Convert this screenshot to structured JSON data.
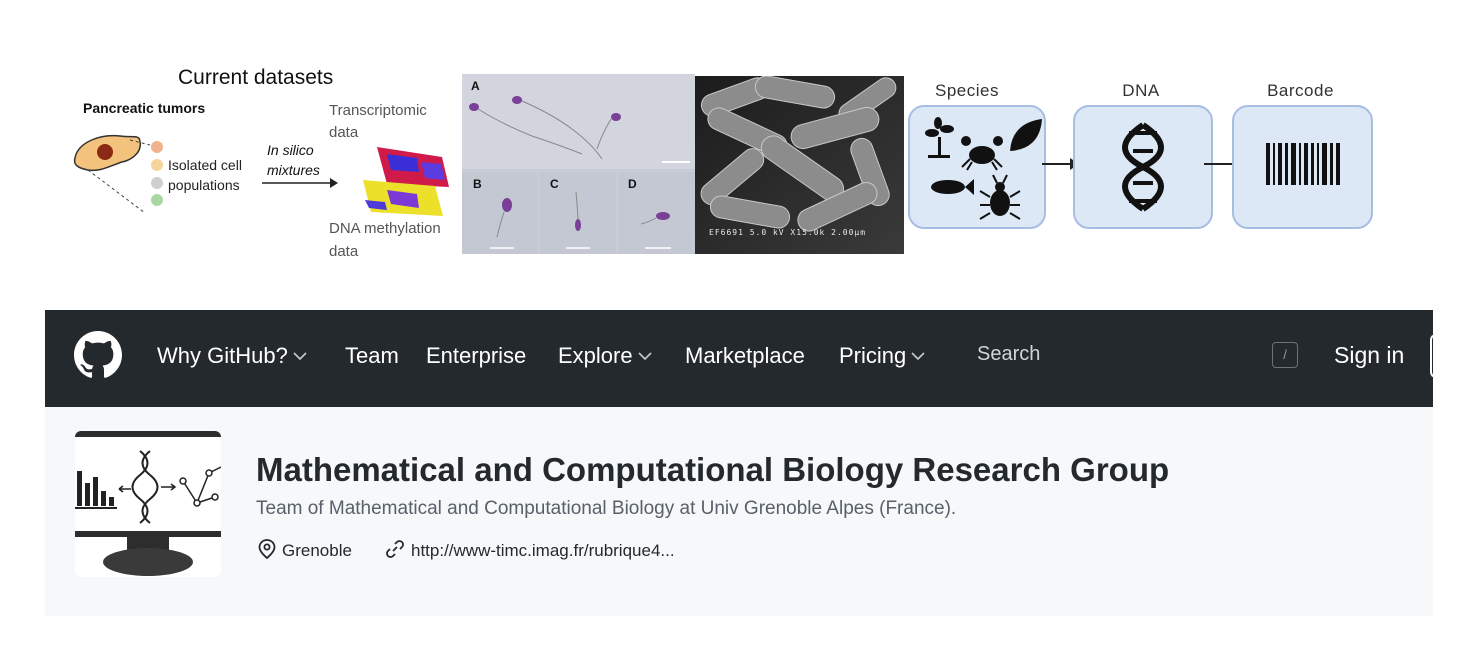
{
  "banner": {
    "datasets": {
      "title": "Current datasets",
      "tumor_label": "Pancreatic tumors",
      "cell_label_1": "Isolated cell",
      "cell_label_2": "populations",
      "arrow_label_1": "In silico",
      "arrow_label_2": "mixtures",
      "transcriptomic_1": "Transcriptomic",
      "transcriptomic_2": "data",
      "methylation_1": "DNA methylation",
      "methylation_2": "data"
    },
    "microscopy": {
      "letters": [
        "A",
        "B",
        "C",
        "D"
      ]
    },
    "sem": {
      "caption": "EF6691 5.0 kV X15.0k 2.00µm"
    },
    "barcoding": {
      "species_label": "Species",
      "dna_label": "DNA",
      "barcode_label": "Barcode"
    }
  },
  "header": {
    "nav": [
      {
        "label": "Why GitHub?",
        "has_menu": true
      },
      {
        "label": "Team",
        "has_menu": false
      },
      {
        "label": "Enterprise",
        "has_menu": false
      },
      {
        "label": "Explore",
        "has_menu": true
      },
      {
        "label": "Marketplace",
        "has_menu": false
      },
      {
        "label": "Pricing",
        "has_menu": true
      }
    ],
    "search_placeholder": "Search",
    "search_shortcut": "/",
    "sign_in_label": "Sign in",
    "icons": {
      "logo": "github-mark-icon",
      "chevron": "chevron-down-icon"
    }
  },
  "org": {
    "name": "Mathematical and Computational Biology Research Group",
    "description": "Team of Mathematical and Computational Biology at Univ Grenoble Alpes (France).",
    "location": "Grenoble",
    "website": "http://www-timc.imag.fr/rubrique4...",
    "icons": {
      "location": "location-pin-icon",
      "website": "link-icon",
      "avatar": "monitor-dna-network-icon"
    }
  },
  "colors": {
    "header_bg": "#24292e",
    "org_bg": "#f6f8fa",
    "org_name": "#24292e",
    "org_desc": "#586069",
    "barcode_box_fill": "#dde8f7",
    "barcode_box_border": "#a7bde2"
  }
}
